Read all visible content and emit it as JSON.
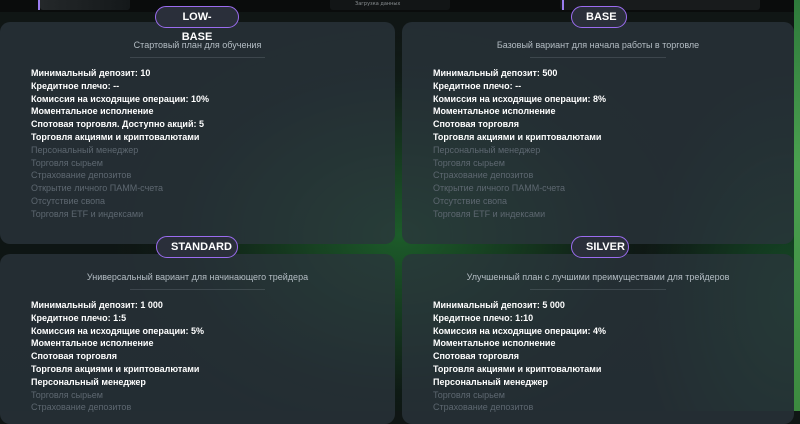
{
  "top_strip": {
    "tiny_text": "Загрузка данных"
  },
  "plans": [
    {
      "badge": "LOW-BASE",
      "subtitle": "Стартовый план для обучения",
      "features": [
        {
          "text": "Минимальный депозит: 10",
          "enabled": true
        },
        {
          "text": "Кредитное плечо: --",
          "enabled": true
        },
        {
          "text": "Комиссия на исходящие операции: 10%",
          "enabled": true
        },
        {
          "text": "Моментальное исполнение",
          "enabled": true
        },
        {
          "text": "Спотовая торговля. Доступно акций: 5",
          "enabled": true
        },
        {
          "text": "Торговля акциями и криптовалютами",
          "enabled": true
        },
        {
          "text": "Персональный менеджер",
          "enabled": false
        },
        {
          "text": "Торговля сырьем",
          "enabled": false
        },
        {
          "text": "Страхование депозитов",
          "enabled": false
        },
        {
          "text": "Открытие личного ПАММ-счета",
          "enabled": false
        },
        {
          "text": "Отсутствие свопа",
          "enabled": false
        },
        {
          "text": "Торговля ETF и индексами",
          "enabled": false
        }
      ]
    },
    {
      "badge": "BASE",
      "subtitle": "Базовый вариант для начала работы в торговле",
      "features": [
        {
          "text": "Минимальный депозит: 500",
          "enabled": true
        },
        {
          "text": "Кредитное плечо: --",
          "enabled": true
        },
        {
          "text": "Комиссия на исходящие операции: 8%",
          "enabled": true
        },
        {
          "text": "Моментальное исполнение",
          "enabled": true
        },
        {
          "text": "Спотовая торговля",
          "enabled": true
        },
        {
          "text": "Торговля акциями и криптовалютами",
          "enabled": true
        },
        {
          "text": "Персональный менеджер",
          "enabled": false
        },
        {
          "text": "Торговля сырьем",
          "enabled": false
        },
        {
          "text": "Страхование депозитов",
          "enabled": false
        },
        {
          "text": "Открытие личного ПАММ-счета",
          "enabled": false
        },
        {
          "text": "Отсутствие свопа",
          "enabled": false
        },
        {
          "text": "Торговля ETF и индексами",
          "enabled": false
        }
      ]
    },
    {
      "badge": "STANDARD",
      "subtitle": "Универсальный вариант для начинающего трейдера",
      "features": [
        {
          "text": "Минимальный депозит: 1 000",
          "enabled": true
        },
        {
          "text": "Кредитное плечо: 1:5",
          "enabled": true
        },
        {
          "text": "Комиссия на исходящие операции: 5%",
          "enabled": true
        },
        {
          "text": "Моментальное исполнение",
          "enabled": true
        },
        {
          "text": "Спотовая торговля",
          "enabled": true
        },
        {
          "text": "Торговля акциями и криптовалютами",
          "enabled": true
        },
        {
          "text": "Персональный менеджер",
          "enabled": true
        },
        {
          "text": "Торговля сырьем",
          "enabled": false
        },
        {
          "text": "Страхование депозитов",
          "enabled": false
        }
      ]
    },
    {
      "badge": "SILVER",
      "subtitle": "Улучшенный план с лучшими преимуществами для трейдеров",
      "features": [
        {
          "text": "Минимальный депозит: 5 000",
          "enabled": true
        },
        {
          "text": "Кредитное плечо: 1:10",
          "enabled": true
        },
        {
          "text": "Комиссия на исходящие операции: 4%",
          "enabled": true
        },
        {
          "text": "Моментальное исполнение",
          "enabled": true
        },
        {
          "text": "Спотовая торговля",
          "enabled": true
        },
        {
          "text": "Торговля акциями и криптовалютами",
          "enabled": true
        },
        {
          "text": "Персональный менеджер",
          "enabled": true
        },
        {
          "text": "Торговля сырьем",
          "enabled": false
        },
        {
          "text": "Страхование депозитов",
          "enabled": false
        }
      ]
    }
  ],
  "colors": {
    "badge_border": "#9b6cf0",
    "card_bg": "#2a343c",
    "feature_on": "#ffffff",
    "feature_off": "#5d6770"
  }
}
